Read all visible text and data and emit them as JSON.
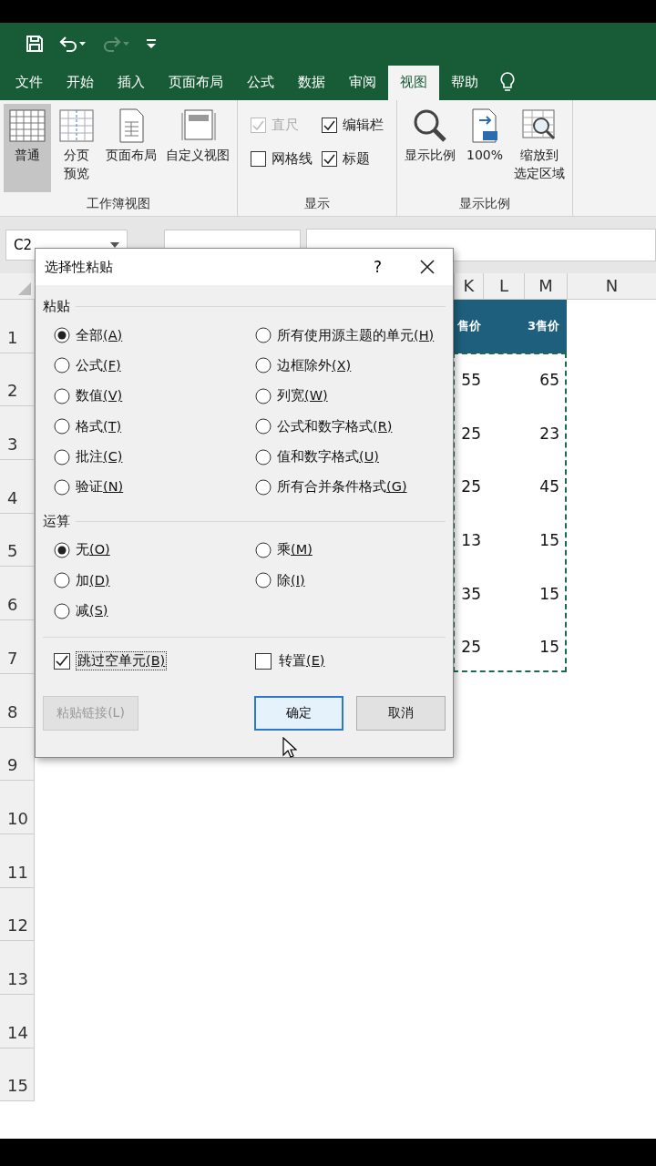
{
  "quick_access": [
    {
      "kind": "save",
      "disabled": false
    },
    {
      "kind": "undo",
      "disabled": false
    },
    {
      "kind": "redo",
      "disabled": true
    },
    {
      "kind": "customize",
      "disabled": false
    }
  ],
  "tabs": [
    {
      "label": "文件",
      "selected": false
    },
    {
      "label": "开始",
      "selected": false
    },
    {
      "label": "插入",
      "selected": false
    },
    {
      "label": "页面布局",
      "selected": false
    },
    {
      "label": "公式",
      "selected": false
    },
    {
      "label": "数据",
      "selected": false
    },
    {
      "label": "审阅",
      "selected": false
    },
    {
      "label": "视图",
      "selected": true
    },
    {
      "label": "帮助",
      "selected": false
    }
  ],
  "ribbon": [
    {
      "title": "工作簿视图",
      "kind": "buttons",
      "items": [
        {
          "lines": [
            "普通"
          ],
          "selected": true
        },
        {
          "lines": [
            "分页",
            "预览"
          ],
          "selected": false
        },
        {
          "lines": [
            "页面布局"
          ],
          "selected": false
        },
        {
          "lines": [
            "自定义视图"
          ],
          "selected": false
        }
      ]
    },
    {
      "title": "显示",
      "kind": "checks",
      "items": [
        {
          "label": "直尺",
          "checked": true,
          "disabled": true
        },
        {
          "label": "编辑栏",
          "checked": true,
          "disabled": false
        },
        {
          "label": "网格线",
          "checked": false,
          "disabled": false
        },
        {
          "label": "标题",
          "checked": true,
          "disabled": false
        }
      ]
    },
    {
      "title": "显示比例",
      "kind": "buttons",
      "items": [
        {
          "lines": [
            "显示比例"
          ],
          "selected": false
        },
        {
          "lines": [
            "100%"
          ],
          "selected": false
        },
        {
          "lines": [
            "缩放到",
            "选定区域"
          ],
          "selected": false
        }
      ]
    }
  ],
  "name_box": "C2",
  "columns": [
    "K",
    "L",
    "M",
    "N"
  ],
  "rows": [
    {
      "number": "1",
      "k": "售价",
      "m": "3售价",
      "header": true
    },
    {
      "number": "2",
      "k": "55",
      "m": "65",
      "header": false
    },
    {
      "number": "3",
      "k": "25",
      "m": "23",
      "header": false
    },
    {
      "number": "4",
      "k": "25",
      "m": "45",
      "header": false
    },
    {
      "number": "5",
      "k": "13",
      "m": "15",
      "header": false
    },
    {
      "number": "6",
      "k": "35",
      "m": "15",
      "header": false
    },
    {
      "number": "7",
      "k": "25",
      "m": "15",
      "header": false
    },
    {
      "number": "8"
    },
    {
      "number": "9"
    },
    {
      "number": "10"
    },
    {
      "number": "11"
    },
    {
      "number": "12"
    },
    {
      "number": "13"
    },
    {
      "number": "14"
    },
    {
      "number": "15"
    }
  ],
  "dialog": {
    "title": "选择性粘贴",
    "help": "?",
    "paste_section": "粘贴",
    "paste_options": [
      {
        "label": "全部",
        "key": "(A)",
        "selected": true
      },
      {
        "label": "所有使用源主题的单元",
        "key": "(H)",
        "selected": false
      },
      {
        "label": "公式",
        "key": "(F)",
        "selected": false
      },
      {
        "label": "边框除外",
        "key": "(X)",
        "selected": false
      },
      {
        "label": "数值",
        "key": "(V)",
        "selected": false
      },
      {
        "label": "列宽",
        "key": "(W)",
        "selected": false
      },
      {
        "label": "格式",
        "key": "(T)",
        "selected": false
      },
      {
        "label": "公式和数字格式",
        "key": "(R)",
        "selected": false
      },
      {
        "label": "批注",
        "key": "(C)",
        "selected": false
      },
      {
        "label": "值和数字格式",
        "key": "(U)",
        "selected": false
      },
      {
        "label": "验证",
        "key": "(N)",
        "selected": false
      },
      {
        "label": "所有合并条件格式",
        "key": "(G)",
        "selected": false
      }
    ],
    "operation_section": "运算",
    "operation_options": [
      {
        "label": "无",
        "key": "(O)",
        "selected": true
      },
      {
        "label": "乘",
        "key": "(M)",
        "selected": false
      },
      {
        "label": "加",
        "key": "(D)",
        "selected": false
      },
      {
        "label": "除",
        "key": "(I)",
        "selected": false
      },
      {
        "label": "减",
        "key": "(S)",
        "selected": false
      }
    ],
    "checkboxes": [
      {
        "label": "跳过空单元",
        "key": "(B)",
        "checked": true,
        "focused": true
      },
      {
        "label": "转置",
        "key": "(E)",
        "checked": false,
        "focused": false
      }
    ],
    "buttons": [
      {
        "label": "粘贴链接(L)",
        "kind": "disabled"
      },
      {
        "label": "确定",
        "kind": "default"
      },
      {
        "label": "取消",
        "kind": "normal"
      }
    ]
  }
}
